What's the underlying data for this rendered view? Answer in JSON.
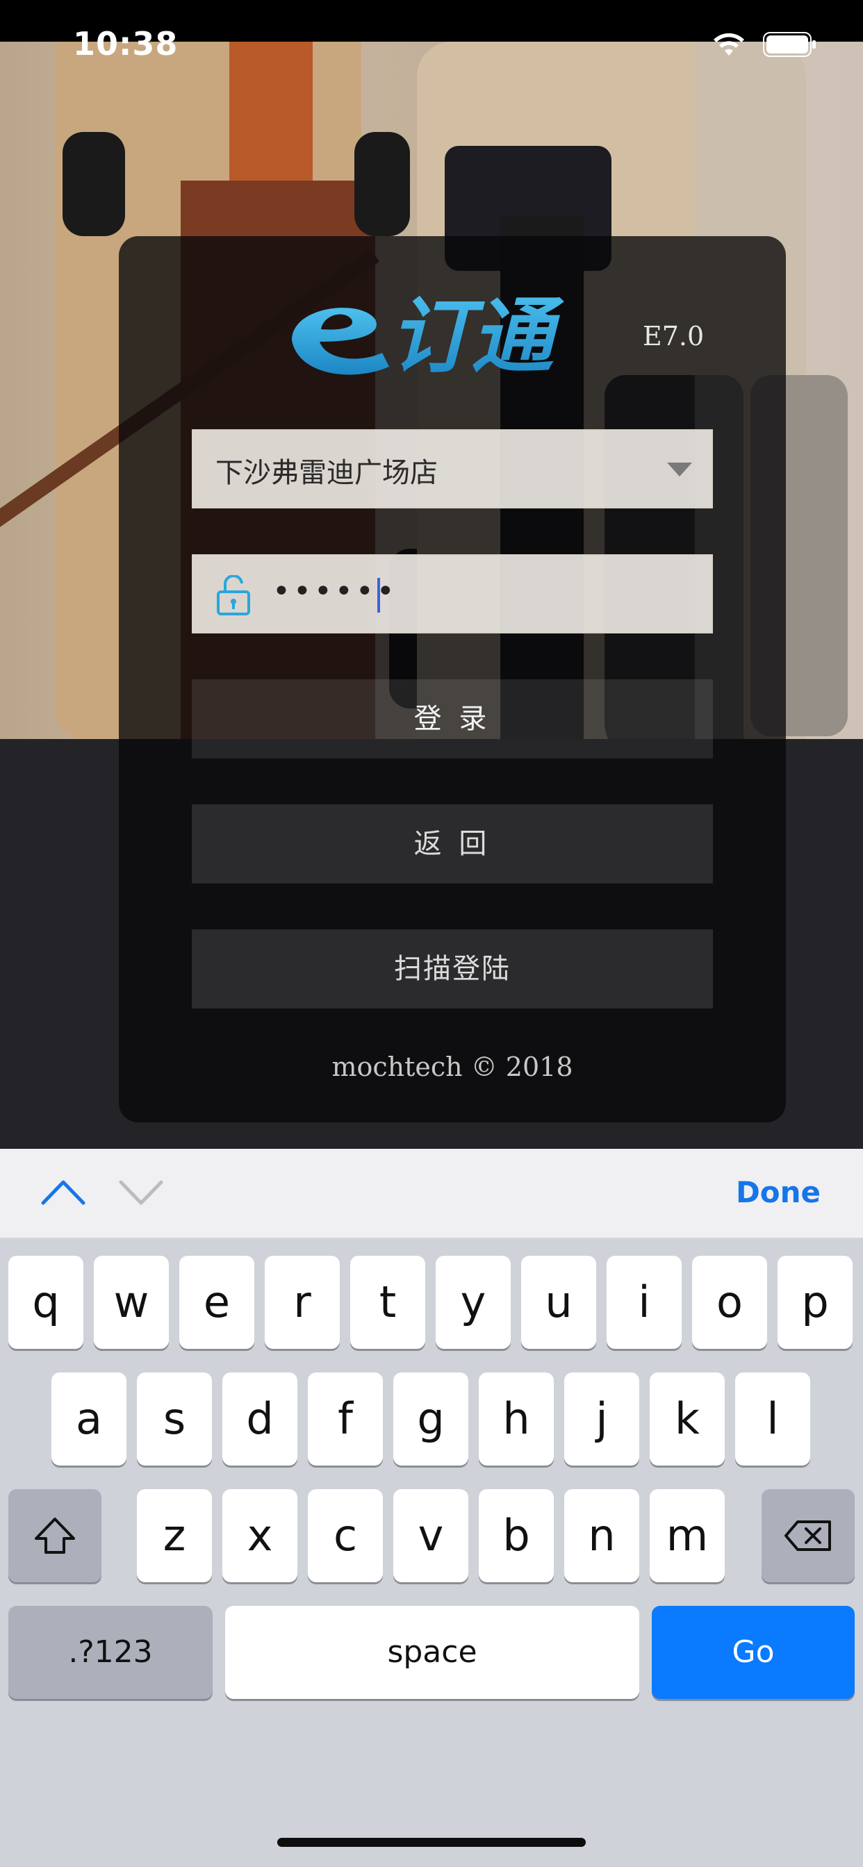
{
  "status_bar": {
    "time": "10:38",
    "wifi_icon": "wifi-icon",
    "battery_icon": "battery-icon"
  },
  "app": {
    "logo_text": "e订通",
    "version": "E7.0",
    "store_select": {
      "value": "下沙弗雷迪广场店",
      "icon": "chevron-down-icon"
    },
    "password_field": {
      "value": "••••••",
      "icon": "unlock-icon"
    },
    "buttons": {
      "login": "登 录",
      "back": "返 回",
      "scan_login": "扫描登陆"
    },
    "copyright": "mochtech © 2018"
  },
  "keyboard": {
    "accessory": {
      "done": "Done",
      "prev_icon": "chevron-up-icon",
      "next_icon": "chevron-down-icon"
    },
    "row1": [
      "q",
      "w",
      "e",
      "r",
      "t",
      "y",
      "u",
      "i",
      "o",
      "p"
    ],
    "row2": [
      "a",
      "s",
      "d",
      "f",
      "g",
      "h",
      "j",
      "k",
      "l"
    ],
    "row3": [
      "z",
      "x",
      "c",
      "v",
      "b",
      "n",
      "m"
    ],
    "shift_icon": "shift-icon",
    "backspace_icon": "backspace-icon",
    "numbers_label": ".?123",
    "space_label": "space",
    "go_label": "Go"
  },
  "colors": {
    "accent": "#0a7aff",
    "logo_blue": "#2aa6dc",
    "card_bg": "#08080a"
  }
}
